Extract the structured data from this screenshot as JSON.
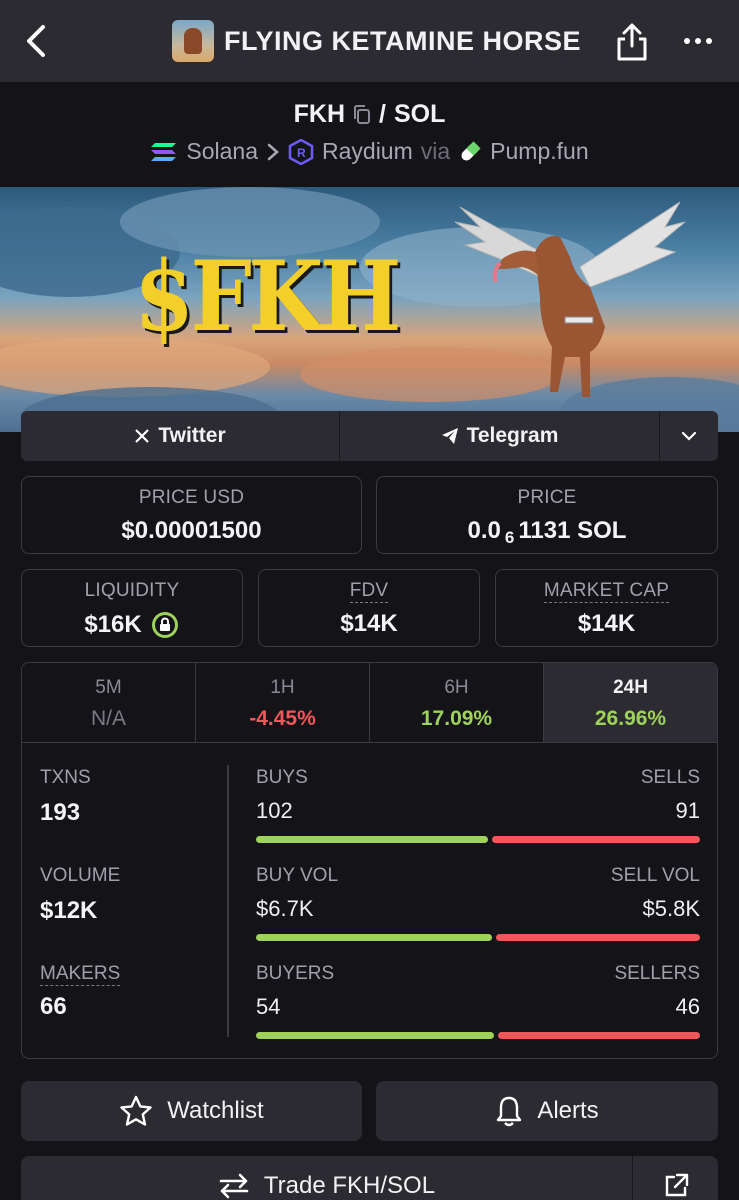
{
  "header": {
    "title": "FLYING KETAMINE HORSE"
  },
  "pair": {
    "base": "FKH",
    "separator": "/",
    "quote": "SOL",
    "chain": "Solana",
    "dex": "Raydium",
    "via_label": "via",
    "launchpad": "Pump.fun"
  },
  "banner": {
    "text": "$FKH"
  },
  "socials": {
    "twitter_label": "Twitter",
    "telegram_label": "Telegram"
  },
  "stats": {
    "price_usd_label": "PRICE USD",
    "price_usd_value": "$0.00001500",
    "price_label": "PRICE",
    "price_prefix": "0.0",
    "price_zeros": "6",
    "price_suffix": "1131 SOL",
    "liquidity_label": "LIQUIDITY",
    "liquidity_value": "$16K",
    "fdv_label": "FDV",
    "fdv_value": "$14K",
    "mcap_label": "MARKET CAP",
    "mcap_value": "$14K"
  },
  "timeframes": [
    {
      "label": "5M",
      "value": "N/A"
    },
    {
      "label": "1H",
      "value": "-4.45%"
    },
    {
      "label": "6H",
      "value": "17.09%"
    },
    {
      "label": "24H",
      "value": "26.96%"
    }
  ],
  "activity": {
    "txns_label": "TXNS",
    "txns_value": "193",
    "volume_label": "VOLUME",
    "volume_value": "$12K",
    "makers_label": "MAKERS",
    "makers_value": "66",
    "buys_label": "BUYS",
    "buys_value": "102",
    "sells_label": "SELLS",
    "sells_value": "91",
    "buy_vol_label": "BUY VOL",
    "buy_vol_value": "$6.7K",
    "sell_vol_label": "SELL VOL",
    "sell_vol_value": "$5.8K",
    "buyers_label": "BUYERS",
    "buyers_value": "54",
    "sellers_label": "SELLERS",
    "sellers_value": "46",
    "buy_share_txns": 0.528,
    "buy_share_vol": 0.536,
    "buy_share_makers": 0.54
  },
  "actions": {
    "watchlist_label": "Watchlist",
    "alerts_label": "Alerts",
    "trade_label": "Trade FKH/SOL"
  },
  "colors": {
    "positive": "#9ed25a",
    "negative": "#f0565a",
    "surface": "#2b2b31",
    "background": "#131318"
  }
}
